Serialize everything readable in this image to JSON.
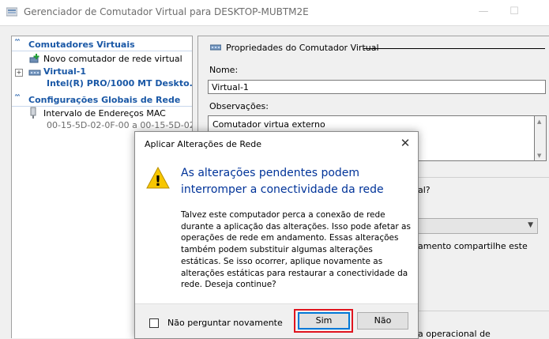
{
  "window": {
    "title": "Gerenciador de Comutador Virtual para DESKTOP-MUBTM2E",
    "minimize_glyph": "—",
    "maximize_glyph": "☐"
  },
  "left": {
    "section_switches": "Comutadores Virtuais",
    "new_switch": "Novo comutador de rede virtual",
    "switch_name": "Virtual-1",
    "switch_adapter": "Intel(R) PRO/1000 MT Deskto...",
    "expand_glyph": "+",
    "section_global": "Configurações Globais de Rede",
    "mac_range_label": "Intervalo de Endereços MAC",
    "mac_range_value": "00-15-5D-02-0F-00 a 00-15-5D-02...",
    "collapse_glyph": "˄˄"
  },
  "right": {
    "group_title": "Propriedades do Comutador Virtual",
    "name_label": "Nome:",
    "name_value": "Virtual-1",
    "notes_label": "Observações:",
    "notes_value": "Comutador virtua externo",
    "frag_question": "al?",
    "frag_share": "amento compartilhe este",
    "frag_operational": "a operacional de"
  },
  "dialog": {
    "title": "Aplicar Alterações de Rede",
    "close_glyph": "✕",
    "heading_line1": "As alterações pendentes podem",
    "heading_line2": "interromper a conectividade da rede",
    "body_lines": [
      "Talvez este computador perca a conexão de rede",
      "durante a aplicação das alterações. Isso pode afetar as",
      "operações de rede em andamento. Essas alterações",
      "também podem substituir algumas alterações",
      "estáticas. Se isso ocorrer, aplique novamente as",
      "alterações estáticas para restaurar a conectividade da",
      "rede. Deseja continue?"
    ],
    "checkbox_label": "Não perguntar novamente",
    "checkbox_checked": false,
    "yes_label": "Sim",
    "no_label": "Não",
    "warning_glyph": "!"
  },
  "colors": {
    "accent_blue": "#1a58a6",
    "heading_blue": "#003399",
    "highlight_red": "#e0141e",
    "warning_yellow": "#f7c600"
  }
}
